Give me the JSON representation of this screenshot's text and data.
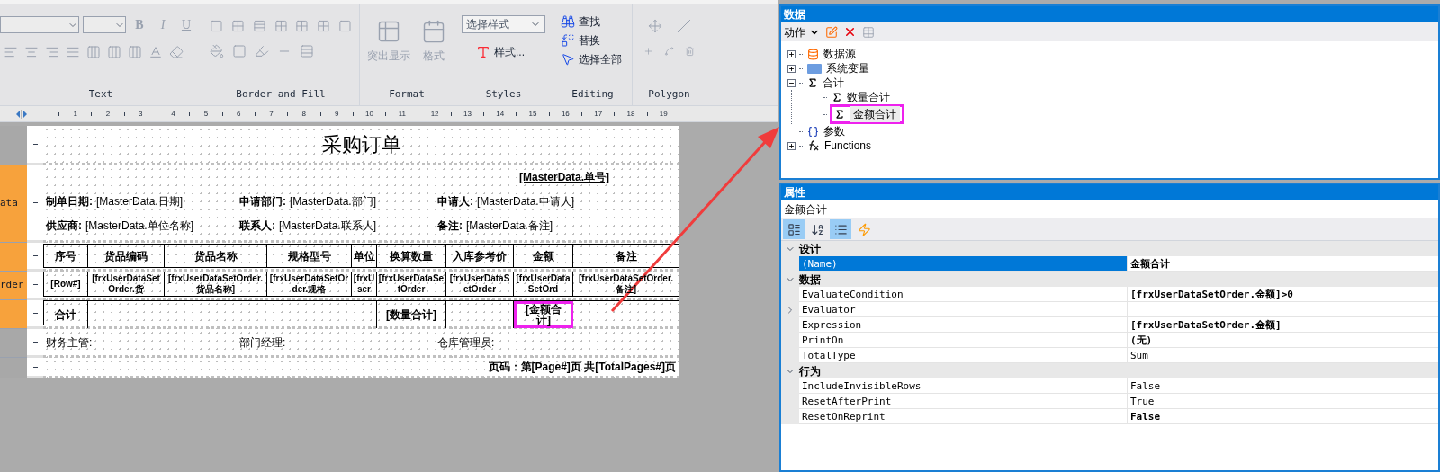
{
  "ribbon": {
    "text_group": {
      "label": "Text",
      "style_buttons": [
        "B",
        "I",
        "U"
      ]
    },
    "border_group": {
      "label": "Border and Fill"
    },
    "format_group": {
      "label": "Format",
      "buttons": [
        {
          "label": "突出显示",
          "disabled": true
        },
        {
          "label": "格式",
          "disabled": true
        }
      ]
    },
    "styles_group": {
      "label": "Styles",
      "style_select": "选择样式",
      "styles_button": "样式..."
    },
    "editing_group": {
      "label": "Editing",
      "buttons": [
        {
          "label": "查找",
          "kind": "find"
        },
        {
          "label": "替换",
          "kind": "replace"
        },
        {
          "label": "选择全部",
          "kind": "select"
        }
      ]
    },
    "polygon_group": {
      "label": "Polygon"
    }
  },
  "ruler": [
    "1",
    "2",
    "3",
    "4",
    "5",
    "6",
    "7",
    "8",
    "9",
    "10",
    "11",
    "12",
    "13",
    "14",
    "15",
    "16",
    "17",
    "18",
    "19"
  ],
  "bands": [
    {
      "color": "#a8a8a8"
    },
    {
      "label": "ata",
      "color": "#f7a23c"
    },
    {
      "color": "#f7a23c"
    },
    {
      "label": "rder",
      "color": "#f7a23c"
    },
    {
      "color": "#f7a23c"
    },
    {
      "color": "#a8a8a8"
    },
    {
      "color": "#a8a8a8"
    }
  ],
  "report": {
    "title": "采购订单",
    "order_no": "[MasterData.单号]",
    "info_rows": [
      [
        {
          "label": "制单日期:",
          "value": "[MasterData.日期]"
        },
        {
          "label": "申请部门:",
          "value": "[MasterData.部门]"
        },
        {
          "label": "申请人:",
          "value": "[MasterData.申请人]"
        }
      ],
      [
        {
          "label": "供应商:",
          "value": "[MasterData.单位名称]"
        },
        {
          "label": "联系人:",
          "value": "[MasterData.联系人]"
        },
        {
          "label": "备注:",
          "value": "[MasterData.备注]"
        }
      ]
    ],
    "table": {
      "columns": [
        "序号",
        "货品编码",
        "货品名称",
        "规格型号",
        "单位",
        "换算数量",
        "入库参考价",
        "金额",
        "备注"
      ],
      "row": [
        "[Row#]",
        "[frxUserDataSetOrder.货",
        "[frxUserDataSetOrder.货品名称]",
        "[frxUserDataSetOrder.规格",
        "[frxUser",
        "[frxUserDataSetOrder",
        "[frxUserDataSetOrder",
        "[frxUserDataSetOrd",
        "[frxUserDataSetOrder.备注]"
      ],
      "total_row": [
        {
          "kind": "cell",
          "text": "合计",
          "highlighted": false
        },
        {
          "kind": "wide_cell",
          "highlighted": false
        },
        {
          "kind": "cell",
          "text": "[数量合计]",
          "highlighted": false
        },
        {
          "kind": "cell",
          "highlighted": false
        },
        {
          "kind": "cell",
          "text": "[金额合计]",
          "highlighted": true
        },
        {
          "kind": "cell",
          "highlighted": false
        }
      ]
    },
    "signatures": [
      "财务主管:",
      "部门经理:",
      "仓库管理员:"
    ],
    "page_footer": "页码：第[Page#]页 共[TotalPages#]页"
  },
  "data_panel": {
    "title": "数据",
    "action_menu": "动作",
    "tree": [
      {
        "label": "数据源",
        "kind": "datasource",
        "expanded": false,
        "highlighted": false
      },
      {
        "label": "系统变量",
        "kind": "variable",
        "expanded": false,
        "highlighted": false
      },
      {
        "label": "合计",
        "kind": "total",
        "expanded": true,
        "highlighted": false,
        "children": [
          {
            "label": "数量合计",
            "kind": "total",
            "highlighted": false
          },
          {
            "label": "金额合计",
            "kind": "total",
            "highlighted": true
          }
        ]
      },
      {
        "label": "参数",
        "kind": "parameter",
        "highlighted": false
      },
      {
        "label": "Functions",
        "kind": "function",
        "expanded": false,
        "highlighted": false
      }
    ]
  },
  "properties_panel": {
    "title": "属性",
    "object_name": "金额合计",
    "toolbar": [
      {
        "kind": "categorized",
        "selected": true
      },
      {
        "kind": "alphabetical",
        "selected": false
      },
      {
        "kind": "properties",
        "selected": true
      },
      {
        "kind": "events",
        "selected": false
      }
    ],
    "categories": [
      {
        "name": "设计",
        "expanded": true,
        "rows": [
          {
            "name": "(Name)",
            "value": "金额合计",
            "bold": true,
            "selected": true
          }
        ]
      },
      {
        "name": "数据",
        "expanded": true,
        "rows": [
          {
            "name": "EvaluateCondition",
            "value": "[frxUserDataSetOrder.金额]>0",
            "bold": true,
            "selected": false
          },
          {
            "name": "Evaluator",
            "bold": false,
            "selected": false,
            "expandable": true
          },
          {
            "name": "Expression",
            "value": "[frxUserDataSetOrder.金额]",
            "bold": true,
            "selected": false
          },
          {
            "name": "PrintOn",
            "value": "(无)",
            "bold": true,
            "selected": false
          },
          {
            "name": "TotalType",
            "value": "Sum",
            "bold": false,
            "selected": false
          }
        ]
      },
      {
        "name": "行为",
        "expanded": true,
        "rows": [
          {
            "name": "IncludeInvisibleRows",
            "value": "False",
            "bold": false,
            "selected": false
          },
          {
            "name": "ResetAfterPrint",
            "value": "True",
            "bold": false,
            "selected": false
          },
          {
            "name": "ResetOnReprint",
            "value": "False",
            "bold": true,
            "selected": false
          }
        ]
      }
    ]
  }
}
